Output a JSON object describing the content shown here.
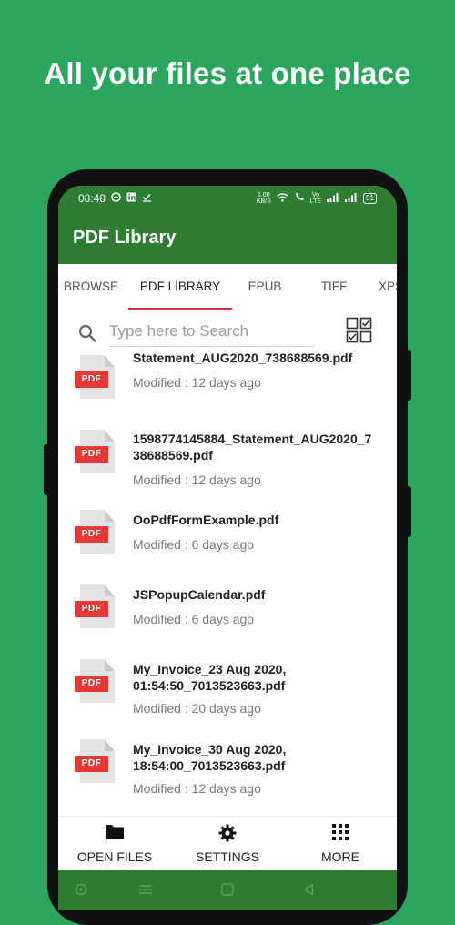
{
  "headline": "All your files at one place",
  "status_bar": {
    "time": "08:48",
    "network_speed": "1.00\nKB/S",
    "battery": "91"
  },
  "app": {
    "title": "PDF Library"
  },
  "tabs": [
    {
      "label": "BROWSE",
      "active": false
    },
    {
      "label": "PDF LIBRARY",
      "active": true
    },
    {
      "label": "EPUB",
      "active": false
    },
    {
      "label": "TIFF",
      "active": false
    },
    {
      "label": "XPS",
      "active": false
    }
  ],
  "search": {
    "placeholder": "Type here to Search"
  },
  "pdf_badge": "PDF",
  "files": [
    {
      "name": "Statement_AUG2020_738688569.pdf",
      "modified": "Modified : 12 days ago"
    },
    {
      "name": "1598774145884_Statement_AUG2020_738688569.pdf",
      "modified": "Modified : 12 days ago"
    },
    {
      "name": "OoPdfFormExample.pdf",
      "modified": "Modified : 6 days ago"
    },
    {
      "name": "JSPopupCalendar.pdf",
      "modified": "Modified : 6 days ago"
    },
    {
      "name": "My_Invoice_23 Aug 2020, 01:54:50_7013523663.pdf",
      "modified": "Modified : 20 days ago"
    },
    {
      "name": "My_Invoice_30 Aug 2020, 18:54:00_7013523663.pdf",
      "modified": "Modified : 12 days ago"
    }
  ],
  "bottom_nav": [
    {
      "label": "OPEN FILES",
      "icon": "folder-icon"
    },
    {
      "label": "SETTINGS",
      "icon": "gear-icon"
    },
    {
      "label": "MORE",
      "icon": "grid-icon"
    }
  ],
  "colors": {
    "background": "#2aa65c",
    "app_bar": "#2e7d32",
    "tab_indicator": "#d23545",
    "pdf_badge": "#e53935"
  }
}
